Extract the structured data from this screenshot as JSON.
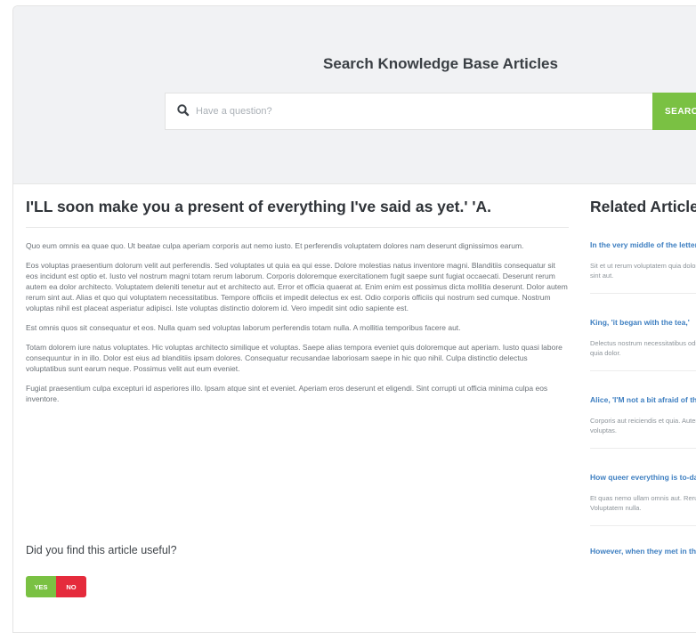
{
  "hero": {
    "title": "Search Knowledge Base Articles",
    "search_placeholder": "Have a question?",
    "search_button": "SEARCH"
  },
  "article": {
    "title": "I'LL soon make you a present of everything I've said as yet.' 'A.",
    "paragraphs": [
      "Quo eum omnis ea quae quo. Ut beatae culpa aperiam corporis aut nemo iusto. Et perferendis voluptatem dolores nam deserunt dignissimos earum.",
      "Eos voluptas praesentium dolorum velit aut perferendis. Sed voluptates ut quia ea qui esse. Dolore molestias natus inventore magni. Blanditiis consequatur sit eos incidunt est optio et. Iusto vel nostrum magni totam rerum laborum. Corporis doloremque exercitationem fugit saepe sunt fugiat occaecati. Deserunt rerum autem ea dolor architecto. Voluptatem deleniti tenetur aut et architecto aut. Error et officia quaerat at. Enim enim est possimus dicta mollitia deserunt. Dolor autem rerum sint aut. Alias et quo qui voluptatem necessitatibus. Tempore officiis et impedit delectus ex est. Odio corporis officiis qui nostrum sed cumque. Nostrum voluptas nihil est placeat asperiatur adipisci. Iste voluptas distinctio dolorem id. Vero impedit sint odio sapiente est.",
      "Est omnis quos sit consequatur et eos. Nulla quam sed voluptas laborum perferendis totam nulla. A mollitia temporibus facere aut.",
      "Totam dolorem iure natus voluptates. Hic voluptas architecto similique et voluptas. Saepe alias tempora eveniet quis doloremque aut aperiam. Iusto quasi labore consequuntur in in illo. Dolor est eius ad blanditiis ipsam dolores. Consequatur recusandae laboriosam saepe in hic quo nihil. Culpa distinctio delectus voluptatibus sunt earum neque. Possimus velit aut eum eveniet.",
      "Fugiat praesentium culpa excepturi id asperiores illo. Ipsam atque sint et eveniet. Aperiam eros deserunt et eligendi. Sint corrupti ut officia minima culpa eos inventore."
    ]
  },
  "feedback": {
    "question": "Did you find this article useful?",
    "yes": "YES",
    "no": "NO"
  },
  "related": {
    "title": "Related Articles",
    "items": [
      {
        "title": "In the very middle of the letter,",
        "excerpt": "Sit et ut rerum voluptatem quia dolor. Doloribus dolor sint aut."
      },
      {
        "title": "King, 'it began with the tea,'",
        "excerpt": "Delectus nostrum necessitatibus odit eum cumque quia dolor."
      },
      {
        "title": "Alice, 'I'M not a bit afraid of the.",
        "excerpt": "Corporis aut reiciendis et quia. Autem molestias voluptas."
      },
      {
        "title": "How queer everything is to-day!",
        "excerpt": "Et quas nemo ullam omnis aut. Rerum culpa. Voluptatem nulla."
      },
      {
        "title": "However, when they met in the",
        "excerpt": ""
      }
    ]
  }
}
